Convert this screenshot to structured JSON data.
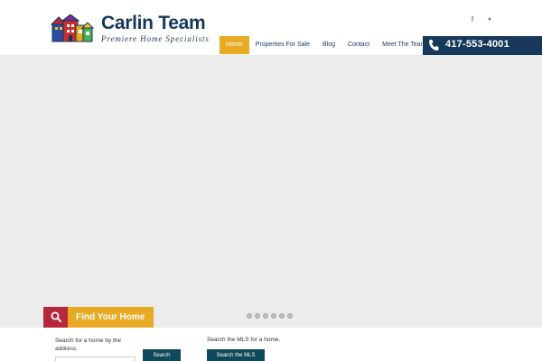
{
  "brand": {
    "title": "Carlin Team",
    "tagline": "Premiere Home Specialists",
    "navy": "#17385a",
    "gold": "#e8a923",
    "red": "#b7263b",
    "teal": "#0f4a5c"
  },
  "social": {
    "facebook": "f",
    "twitter": "✦"
  },
  "nav": {
    "items": [
      {
        "label": "Home",
        "active": true
      },
      {
        "label": "Properties For Sale",
        "active": false
      },
      {
        "label": "Blog",
        "active": false
      },
      {
        "label": "Contact",
        "active": false
      },
      {
        "label": "Meet The Team",
        "active": false
      }
    ]
  },
  "phone": {
    "icon": "phone-icon",
    "number": "417-553-4001"
  },
  "slider": {
    "prev": "‹",
    "next": "›",
    "slide_count": 6
  },
  "find": {
    "icon": "search-icon",
    "label": "Find Your Home"
  },
  "search_panel": {
    "address_text": "Search for a home by the address.",
    "address_placeholder": "",
    "search_button": "Search",
    "mls_text": "Search the MLS for a home.",
    "mls_button": "Search the MLS"
  }
}
